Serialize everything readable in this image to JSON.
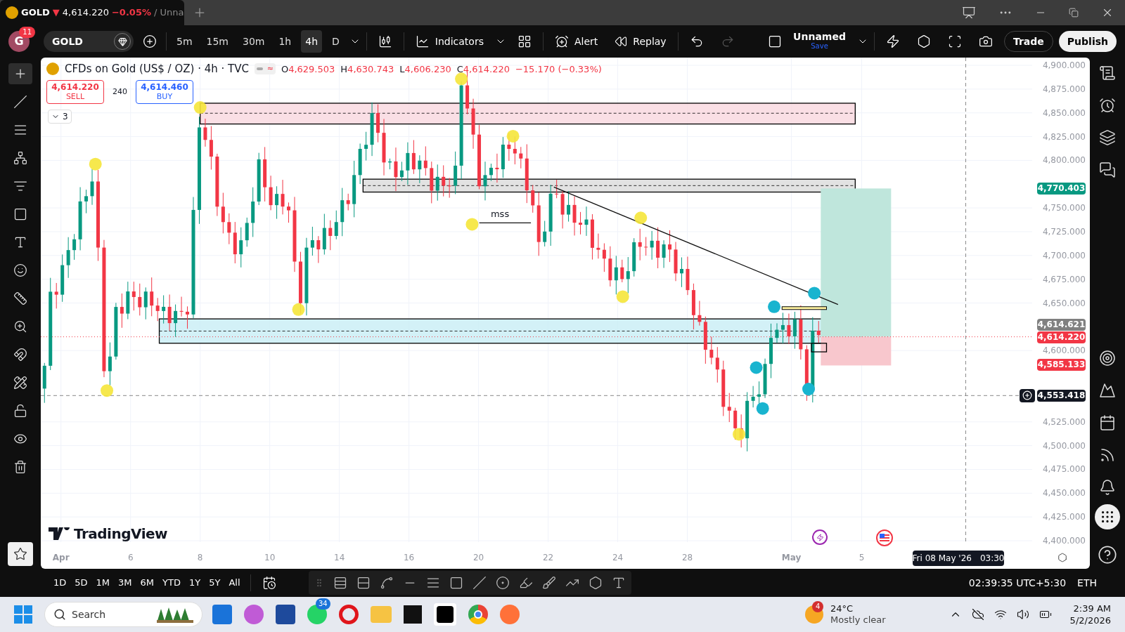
{
  "tab": {
    "symbol": "GOLD",
    "direction": "▼",
    "price": "4,614.220",
    "change": "−0.05%",
    "rest": "/ Unna"
  },
  "toolbar": {
    "avatar": "G",
    "notifications": "11",
    "symbol": "GOLD",
    "intervals": [
      {
        "label": "5m",
        "selected": false
      },
      {
        "label": "15m",
        "selected": false
      },
      {
        "label": "30m",
        "selected": false
      },
      {
        "label": "1h",
        "selected": false
      },
      {
        "label": "4h",
        "selected": true
      },
      {
        "label": "D",
        "selected": false
      }
    ],
    "indicators": "Indicators",
    "alert": "Alert",
    "replay": "Replay",
    "layout_name": "Unnamed",
    "save": "Save",
    "trade": "Trade",
    "publish": "Publish"
  },
  "legend": {
    "title": "CFDs on Gold (US$ / OZ) · 4h · TVC",
    "ohlc": [
      {
        "key": "O",
        "value": "4,629.503"
      },
      {
        "key": "H",
        "value": "4,630.743"
      },
      {
        "key": "L",
        "value": "4,606.230"
      },
      {
        "key": "C",
        "value": "4,614.220"
      }
    ],
    "change": "−15.170 (−0.33%)",
    "toggle_symbol": "≈"
  },
  "trade_panel": {
    "sell_price": "4,614.220",
    "sell": "SELL",
    "quantity": "240",
    "buy_price": "4,614.460",
    "buy": "BUY"
  },
  "indicators_count": "3",
  "chart": {
    "annotation": "mss",
    "logo_text": "TradingView",
    "price_scale": [
      "4,900.000",
      "4,875.000",
      "4,850.000",
      "4,825.000",
      "4,800.000",
      "4,750.000",
      "4,725.000",
      "4,700.000",
      "4,675.000",
      "4,650.000",
      "4,600.000",
      "4,525.000",
      "4,500.000",
      "4,475.000",
      "4,450.000",
      "4,425.000",
      "4,400.000"
    ],
    "price_tags": [
      {
        "value": "4,770.403",
        "color": "#089981"
      },
      {
        "value": "4,614.621",
        "color": "#808080"
      },
      {
        "value": "4,614.220",
        "color": "#f23645"
      },
      {
        "value": "4,585.133",
        "color": "#f23645"
      },
      {
        "value": "4,553.418",
        "color": "#131722"
      }
    ],
    "time_scale": [
      "Apr",
      "6",
      "8",
      "10",
      "14",
      "16",
      "20",
      "22",
      "24",
      "28",
      "May",
      "5"
    ],
    "crosshair_date": "Fri 08 May '26",
    "crosshair_time": "03:30"
  },
  "bottom_bar": {
    "ranges": [
      "1D",
      "5D",
      "1M",
      "3M",
      "6M",
      "YTD",
      "1Y",
      "5Y",
      "All"
    ],
    "clock": "02:39:35 UTC+5:30",
    "session": "ETH"
  },
  "taskbar": {
    "search_placeholder": "Search",
    "whatsapp_badge": "34",
    "weather_badge": "4",
    "temperature": "24°C",
    "weather": "Mostly clear",
    "time": "2:39 AM",
    "date": "5/2/2026"
  }
}
